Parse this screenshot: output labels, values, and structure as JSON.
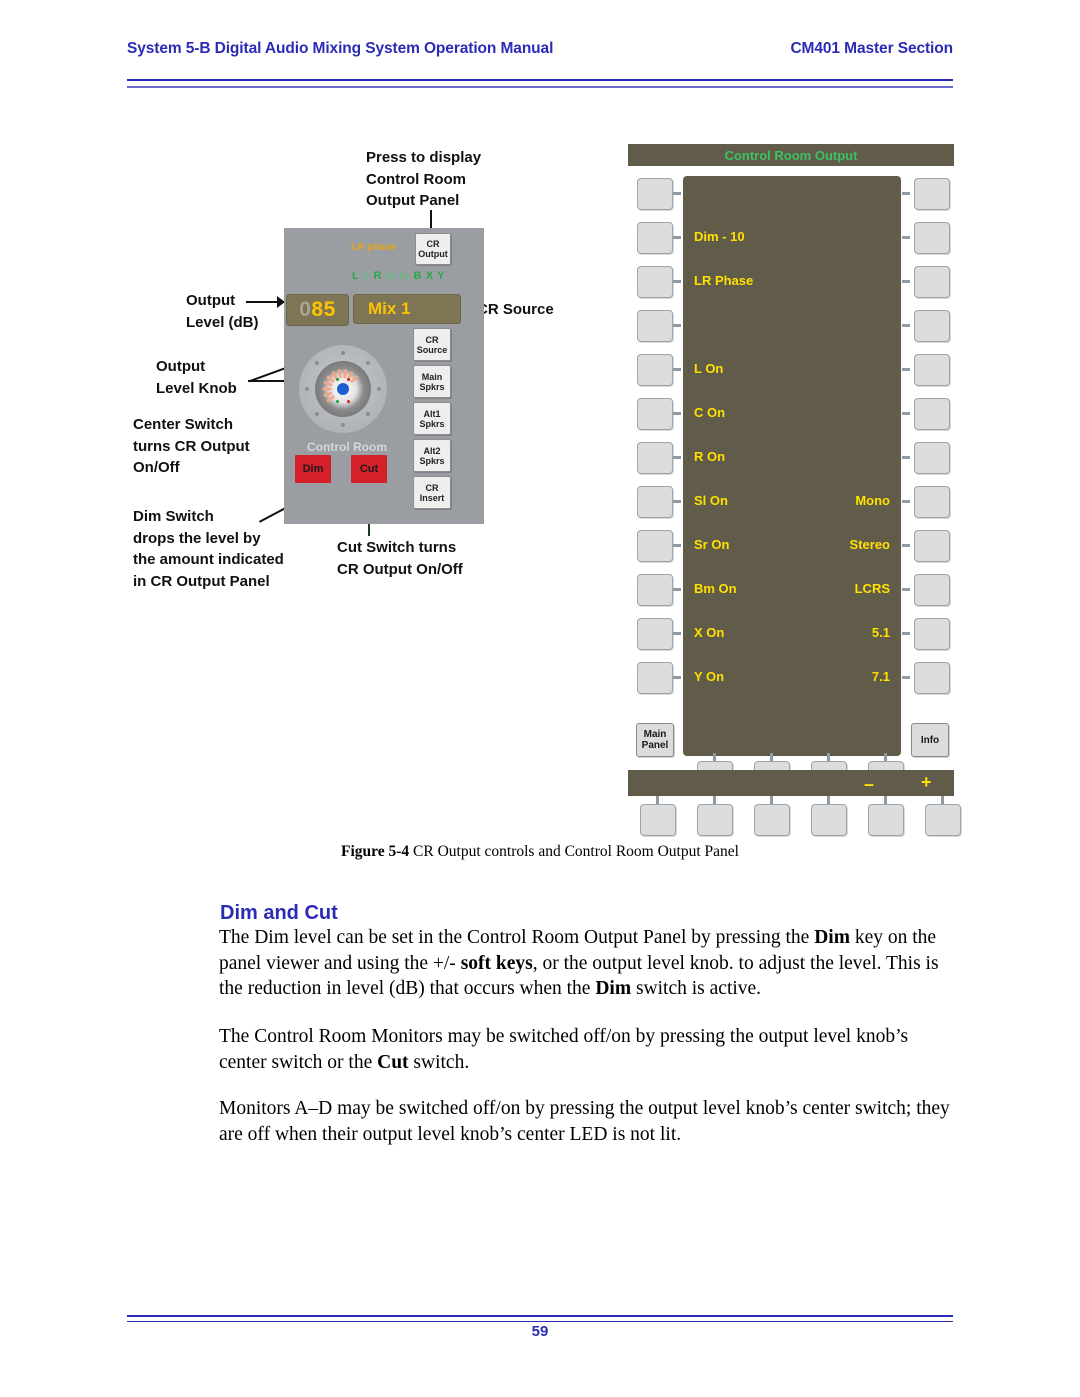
{
  "header": {
    "left": "System 5-B Digital Audio Mixing System Operation Manual",
    "right": "CM401 Master Section"
  },
  "footer": {
    "page_number": "59"
  },
  "colors": {
    "header_blue": "#2b2bb5",
    "panel_grey": "#9a9ea3",
    "display_olive": "#7d7554",
    "display_yellow": "#ffc400",
    "viewer_olive": "#605c49",
    "viewer_yellow": "#ffe000",
    "viewer_green": "#3dc162",
    "led_green": "#2aa84a",
    "red_switch": "#d5202c",
    "lr_phase_amber": "#e8a317"
  },
  "figure": {
    "callouts": [
      {
        "id": "press-to-display",
        "text": "Press to display\nControl Room\nOutput Panel"
      },
      {
        "id": "output-level-db",
        "text": "Output\nLevel (dB)"
      },
      {
        "id": "cr-source",
        "text": "CR Source"
      },
      {
        "id": "output-level-knob",
        "text": "Output\nLevel Knob"
      },
      {
        "id": "center-switch",
        "text": "Center Switch\nturns CR Output\nOn/Off"
      },
      {
        "id": "dim-switch",
        "text": "Dim Switch\ndrops the level by\nthe amount indicated\nin CR Output Panel"
      },
      {
        "id": "cut-switch",
        "text": "Cut Switch turns\nCR Output On/Off"
      }
    ],
    "console": {
      "lr_phase_label": "LR phase",
      "cr_output_button": {
        "line1": "CR",
        "line2": "Output"
      },
      "channel_leds": [
        "L",
        "C",
        "R",
        "Sl",
        "Sr",
        "B",
        "X",
        "Y"
      ],
      "level_display": {
        "leading": "0",
        "value": "85"
      },
      "source_display": "Mix 1",
      "section_label": "Control Room",
      "side_buttons": [
        {
          "line1": "CR",
          "line2": "Source"
        },
        {
          "line1": "Main",
          "line2": "Spkrs"
        },
        {
          "line1": "Alt1",
          "line2": "Spkrs"
        },
        {
          "line1": "Alt2",
          "line2": "Spkrs"
        },
        {
          "line1": "CR",
          "line2": "Insert"
        }
      ],
      "red_switches": [
        "Dim",
        "Cut"
      ]
    },
    "viewer": {
      "title": "Control Room Output",
      "left_labels": [
        "",
        "Dim - 10",
        "LR Phase",
        "",
        "L On",
        "C On",
        "R On",
        "Sl On",
        "Sr On",
        "Bm On",
        "X On",
        "Y On"
      ],
      "right_labels": [
        "",
        "",
        "",
        "",
        "",
        "",
        "",
        "Mono",
        "Stereo",
        "LCRS",
        "5.1",
        "7.1"
      ],
      "main_panel_button": {
        "line1": "Main",
        "line2": "Panel"
      },
      "info_button": "Info",
      "minus_sign": "–",
      "plus_sign": "+"
    }
  },
  "caption": {
    "bold": "Figure 5-4",
    "text": " CR Output controls and Control Room Output Panel"
  },
  "section": {
    "heading": "Dim and Cut",
    "paragraph_1_a": "The Dim level can be set in the Control Room Output Panel by pressing the ",
    "paragraph_1_b": "Dim",
    "paragraph_1_c": " key on the panel viewer and using the +/- ",
    "paragraph_1_d": "soft keys",
    "paragraph_1_e": ", or the output level knob. to adjust the level. This is the reduction in level (dB) that occurs when the ",
    "paragraph_1_f": "Dim",
    "paragraph_1_g": " switch is active.",
    "paragraph_2_a": "The Control Room Monitors may be switched off/on by pressing the output level knob’s center switch or the ",
    "paragraph_2_b": "Cut",
    "paragraph_2_c": " switch.",
    "paragraph_3": "Monitors A–D may be switched off/on by pressing the output level knob’s center switch; they are off when their output level knob’s center LED is not lit."
  }
}
